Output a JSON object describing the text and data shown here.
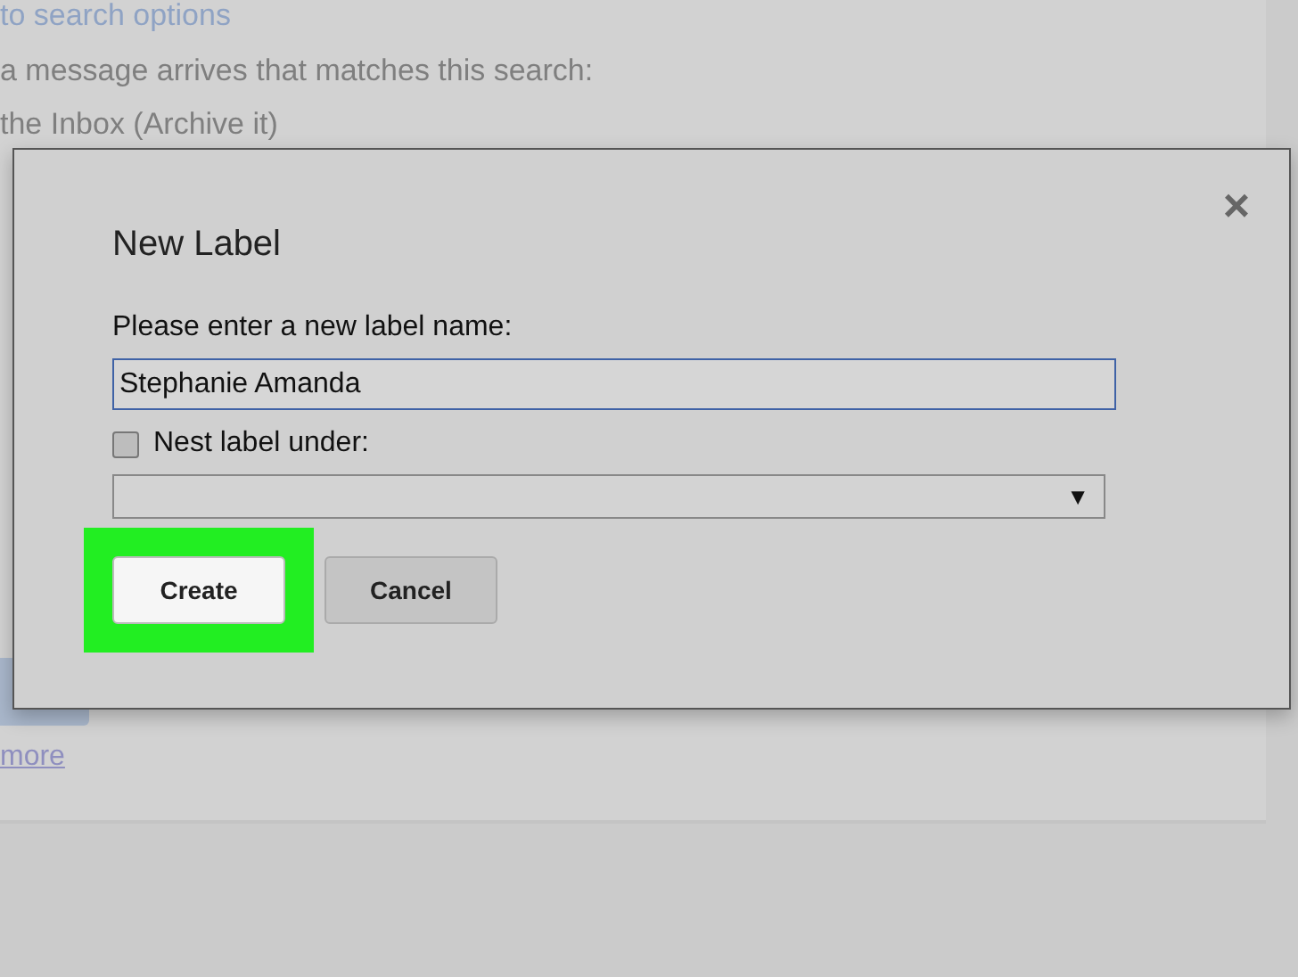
{
  "background": {
    "back_link": "to search options",
    "filter_text": "a message arrives that matches this search:",
    "option_text": "the Inbox (Archive it)",
    "more_link": "more"
  },
  "dialog": {
    "title": "New Label",
    "close": "×",
    "prompt": "Please enter a new label name:",
    "name_value": "Stephanie Amanda",
    "nest": {
      "label": "Nest label under:",
      "checked": false
    },
    "parent_select": {
      "caret": "▼"
    },
    "buttons": [
      {
        "label": "Create",
        "kind": "primary",
        "highlighted": true
      },
      {
        "label": "Cancel",
        "kind": "secondary",
        "highlighted": false
      }
    ]
  }
}
